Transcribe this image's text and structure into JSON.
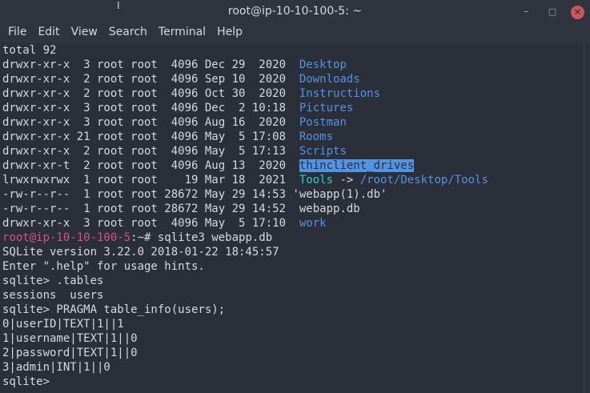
{
  "window": {
    "title": "root@ip-10-10-100-5: ~",
    "buttons": {
      "minimize": "–",
      "maximize": "□",
      "close": "✕"
    }
  },
  "menu": [
    "File",
    "Edit",
    "View",
    "Search",
    "Terminal",
    "Help"
  ],
  "terminal": {
    "total": "total 92",
    "entries": [
      {
        "meta": "drwxr-xr-x  3 root root  4096 Dec 29  2020  ",
        "name": "Desktop"
      },
      {
        "meta": "drwxr-xr-x  2 root root  4096 Sep 10  2020  ",
        "name": "Downloads"
      },
      {
        "meta": "drwxr-xr-x  2 root root  4096 Oct 30  2020  ",
        "name": "Instructions"
      },
      {
        "meta": "drwxr-xr-x  3 root root  4096 Dec  2 10:18  ",
        "name": "Pictures"
      },
      {
        "meta": "drwxr-xr-x  3 root root  4096 Aug 16  2020  ",
        "name": "Postman"
      },
      {
        "meta": "drwxr-xr-x 21 root root  4096 May  5 17:08  ",
        "name": "Rooms"
      },
      {
        "meta": "drwxr-xr-x  2 root root  4096 May  5 17:13  ",
        "name": "Scripts"
      },
      {
        "meta": "drwxr-xr-t  2 root root  4096 Aug 13  2020  ",
        "name": "thinclient_drives"
      },
      {
        "meta": "lrwxrwxrwx  1 root root    19 Mar 18  2021  ",
        "name": "Tools",
        "arrow": " -> ",
        "target": "/root/Desktop/Tools"
      },
      {
        "meta": "-rw-r--r--  1 root root 28672 May 29 14:53 ",
        "name": "'webapp(1).db'"
      },
      {
        "meta": "-rw-r--r--  1 root root 28672 May 29 14:52  ",
        "name": "webapp.db"
      },
      {
        "meta": "drwxr-xr-x  3 root root  4096 May  5 17:10  ",
        "name": "work"
      }
    ],
    "prompt_user": "root@ip-10-10-100-5",
    "prompt_rest": ":~# ",
    "command": "sqlite3 webapp.db",
    "output": [
      "SQLite version 3.22.0 2018-01-22 18:45:57",
      "Enter \".help\" for usage hints.",
      "sqlite> .tables",
      "sessions  users",
      "sqlite> PRAGMA table_info(users);",
      "0|userID|TEXT|1||1",
      "1|username|TEXT|1||0",
      "2|password|TEXT|1||0",
      "3|admin|INT|1||0",
      "sqlite> "
    ]
  }
}
